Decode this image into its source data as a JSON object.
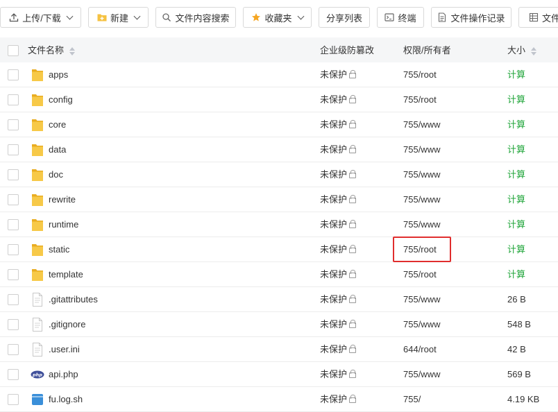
{
  "toolbar": {
    "upload_label": "上传/下载",
    "new_label": "新建",
    "search_label": "文件内容搜索",
    "favorites_label": "收藏夹",
    "share_label": "分享列表",
    "terminal_label": "终端",
    "log_label": "文件操作记录",
    "extra_label": "文件"
  },
  "table": {
    "headers": {
      "name": "文件名称",
      "protection": "企业级防篡改",
      "permission": "权限/所有者",
      "size": "大小"
    },
    "rows": [
      {
        "name": "apps",
        "type": "folder",
        "protection": "未保护",
        "permission": "755/root",
        "size": "计算"
      },
      {
        "name": "config",
        "type": "folder",
        "protection": "未保护",
        "permission": "755/root",
        "size": "计算"
      },
      {
        "name": "core",
        "type": "folder",
        "protection": "未保护",
        "permission": "755/www",
        "size": "计算"
      },
      {
        "name": "data",
        "type": "folder",
        "protection": "未保护",
        "permission": "755/www",
        "size": "计算"
      },
      {
        "name": "doc",
        "type": "folder",
        "protection": "未保护",
        "permission": "755/www",
        "size": "计算"
      },
      {
        "name": "rewrite",
        "type": "folder",
        "protection": "未保护",
        "permission": "755/www",
        "size": "计算"
      },
      {
        "name": "runtime",
        "type": "folder",
        "protection": "未保护",
        "permission": "755/www",
        "size": "计算"
      },
      {
        "name": "static",
        "type": "folder",
        "protection": "未保护",
        "permission": "755/root",
        "size": "计算"
      },
      {
        "name": "template",
        "type": "folder",
        "protection": "未保护",
        "permission": "755/root",
        "size": "计算"
      },
      {
        "name": ".gitattributes",
        "type": "file",
        "protection": "未保护",
        "permission": "755/www",
        "size": "26 B"
      },
      {
        "name": ".gitignore",
        "type": "file",
        "protection": "未保护",
        "permission": "755/www",
        "size": "548 B"
      },
      {
        "name": ".user.ini",
        "type": "file",
        "protection": "未保护",
        "permission": "644/root",
        "size": "42 B"
      },
      {
        "name": "api.php",
        "type": "php",
        "protection": "未保护",
        "permission": "755/www",
        "size": "569 B"
      },
      {
        "name": "fu.log.sh",
        "type": "script",
        "protection": "未保护",
        "permission": "755/",
        "size": "4.19 KB"
      }
    ]
  },
  "colors": {
    "accent_green": "#20a53a",
    "highlight_red": "#e02d2d",
    "folder_yellow": "#f5c242"
  }
}
